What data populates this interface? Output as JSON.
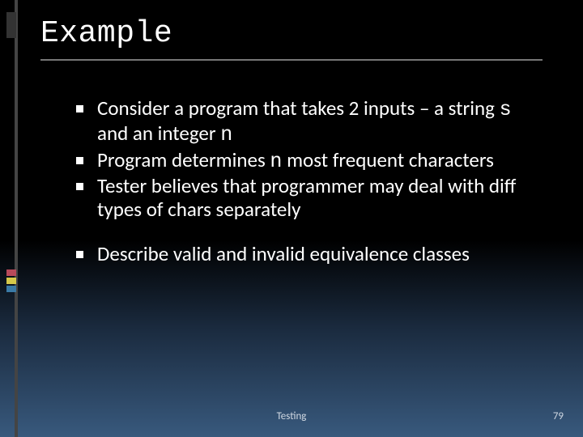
{
  "title": "Example",
  "bullets_group1": [
    {
      "pre": "Consider a program that takes 2 inputs – a string ",
      "mono1": "s",
      "mid": " and an integer ",
      "mono2": "n",
      "post": ""
    },
    {
      "pre": "Program determines ",
      "mono1": "n",
      "mid": " most frequent characters",
      "mono2": "",
      "post": ""
    },
    {
      "pre": "Tester believes that programmer may deal with diff types of chars separately",
      "mono1": "",
      "mid": "",
      "mono2": "",
      "post": ""
    }
  ],
  "bullets_group2": [
    {
      "pre": "Describe valid and invalid equivalence classes",
      "mono1": "",
      "mid": "",
      "mono2": "",
      "post": ""
    }
  ],
  "footer": {
    "label": "Testing",
    "page": "79"
  }
}
